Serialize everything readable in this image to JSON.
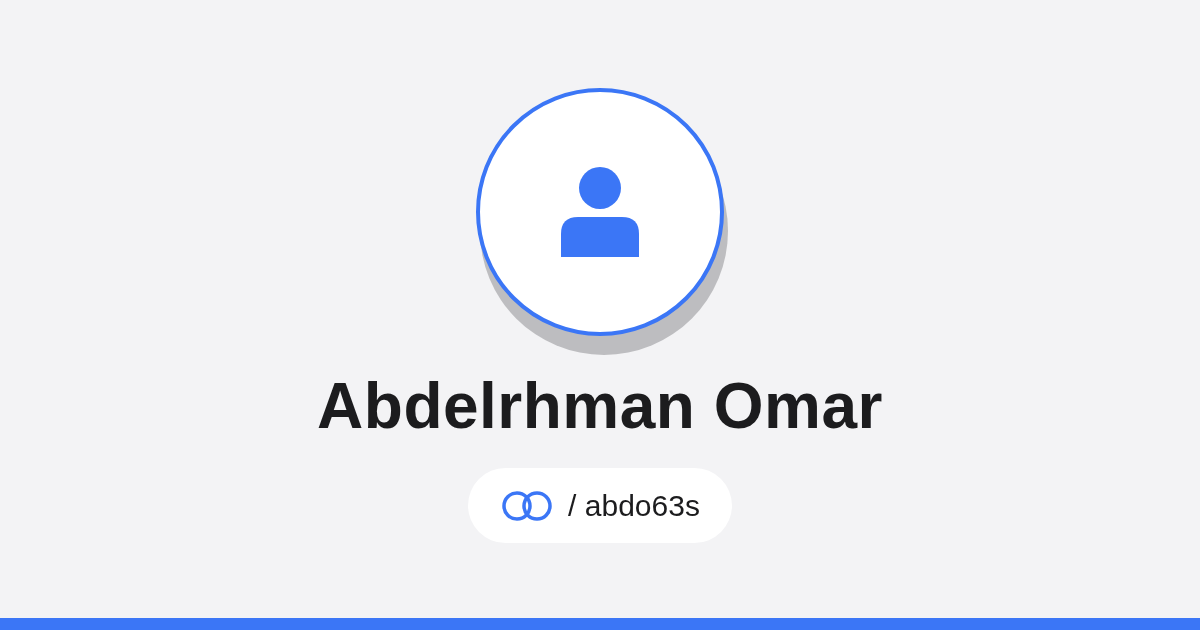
{
  "profile": {
    "name": "Abdelrhman Omar",
    "handle": "/ abdo63s"
  }
}
